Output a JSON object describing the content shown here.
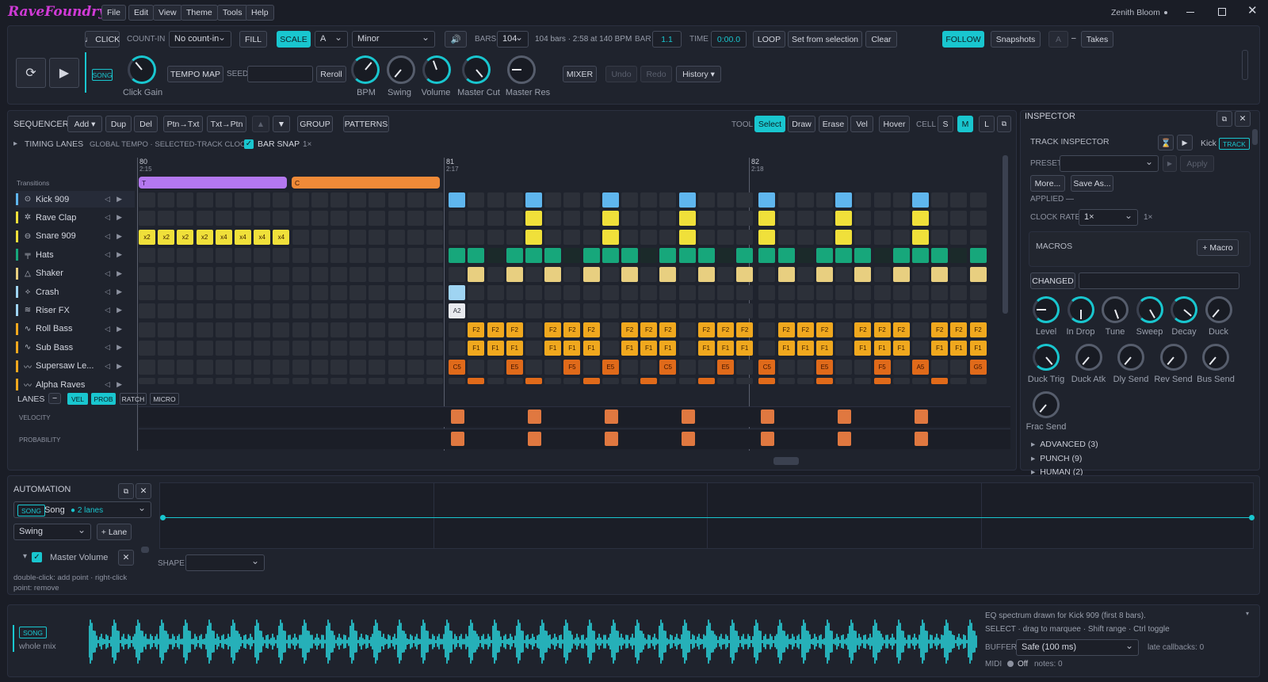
{
  "app": {
    "logo": "RaveFoundry",
    "user": "Zenith Bloom",
    "menus": [
      "File",
      "Edit",
      "View",
      "Theme",
      "Tools",
      "Help"
    ]
  },
  "transport": {
    "click": "♩ CLICK",
    "count_in_label": "COUNT-IN",
    "count_in": "No count-in",
    "fill": "FILL",
    "scale": "SCALE",
    "key": "A",
    "mode": "Minor",
    "bars_label": "BARS",
    "bars": "104",
    "bars_info": "104 bars · 2:58 at 140 BPM",
    "bar_label": "BAR",
    "bar": "1.1",
    "time_label": "TIME",
    "time": "0:00.0",
    "loop": "LOOP",
    "set_from_sel": "Set from selection",
    "clear": "Clear",
    "follow": "FOLLOW",
    "snapshots": "Snapshots",
    "snap_a": "A",
    "snap_dash": "–",
    "takes": "Takes",
    "song_badge": "SONG",
    "tempo_map": "TEMPO MAP",
    "seed_label": "SEED",
    "reroll": "Reroll",
    "mixer": "MIXER",
    "undo": "Undo",
    "redo": "Redo",
    "history": "History ▾",
    "knobs": [
      "Click Gain",
      "BPM",
      "Swing",
      "Volume",
      "Master Cut",
      "Master Res"
    ]
  },
  "sequencer": {
    "title": "SEQUENCER",
    "add": "Add ▾",
    "dup": "Dup",
    "del": "Del",
    "ptn_txt": "Ptn→Txt",
    "txt_ptn": "Txt→Ptn",
    "group": "GROUP",
    "patterns": "PATTERNS",
    "tool_label": "TOOL",
    "tools": [
      "Select",
      "Draw",
      "Erase",
      "Vel"
    ],
    "hover": "Hover",
    "cell_label": "CELL",
    "cells": [
      "S",
      "M",
      "L"
    ],
    "timing": "TIMING LANES",
    "timing_info": "GLOBAL TEMPO · SELECTED-TRACK CLOCK",
    "bar_snap": "BAR SNAP",
    "snap_mult": "1×",
    "ruler": [
      {
        "bar": "80",
        "time": "2:15"
      },
      {
        "bar": "81",
        "time": "2:17"
      },
      {
        "bar": "82",
        "time": "2:18"
      }
    ],
    "transitions_label": "Transitions",
    "transition_t": "T",
    "transition_c": "C",
    "tracks": [
      {
        "name": "Kick 909",
        "color": "#5fb6ee"
      },
      {
        "name": "Rave Clap",
        "color": "#f0e03a"
      },
      {
        "name": "Snare 909",
        "color": "#f0e03a"
      },
      {
        "name": "Hats",
        "color": "#17a77b"
      },
      {
        "name": "Shaker",
        "color": "#e8cf80"
      },
      {
        "name": "Crash",
        "color": "#9fd4f2"
      },
      {
        "name": "Riser FX",
        "color": "#9fd4f2"
      },
      {
        "name": "Roll Bass",
        "color": "#f0a81e"
      },
      {
        "name": "Sub Bass",
        "color": "#f0a81e"
      },
      {
        "name": "Supersaw Le...",
        "color": "#f0a81e"
      },
      {
        "name": "Alpha Raves",
        "color": "#f0a81e"
      }
    ],
    "note_labels": {
      "crash": "A2",
      "f2": "F2",
      "f1": "F1",
      "c5": "C5",
      "e5": "E5",
      "f5": "F5",
      "a5": "A5",
      "g5": "G5",
      "x2": "x2",
      "x4": "x4"
    },
    "lanes_label": "LANES",
    "lanes_minus": "−",
    "lane_tabs": [
      "VEL",
      "PROB",
      "RATCH",
      "MICRO"
    ],
    "lane_rows": [
      "VELOCITY",
      "PROBABILITY"
    ]
  },
  "inspector": {
    "title": "INSPECTOR",
    "track_inspector": "TRACK INSPECTOR",
    "track": "Kick",
    "track_badge": "TRACK",
    "preset_label": "PRESET",
    "apply": "Apply",
    "more": "More...",
    "save_as": "Save As...",
    "applied": "APPLIED —",
    "clock_rate_label": "CLOCK RATE",
    "clock_rate": "1×",
    "clock_rate_suffix": "1×",
    "macros": "MACROS",
    "add_macro": "+ Macro",
    "changed": "CHANGED",
    "knobs": [
      "Level",
      "In Drop",
      "Tune",
      "Sweep",
      "Decay",
      "Duck",
      "Duck Trig",
      "Duck Atk",
      "Dly Send",
      "Rev Send",
      "Bus Send",
      "Frac Send"
    ],
    "sections": [
      "ADVANCED (3)",
      "PUNCH (9)",
      "HUMAN (2)"
    ]
  },
  "automation": {
    "title": "AUTOMATION",
    "song_badge": "SONG",
    "song": "Song",
    "lanes": "● 2 lanes",
    "param": "Swing",
    "add_lane": "+ Lane",
    "master_volume": "Master Volume",
    "shape_label": "SHAPE",
    "hint": "double-click: add point · right-click point: remove"
  },
  "bottom": {
    "song_badge": "SONG",
    "mix": "whole mix",
    "eq_info": "EQ spectrum drawn for Kick 909 (first 8 bars).",
    "select_info": "SELECT · drag to marquee · Shift range · Ctrl toggle",
    "buffer_label": "BUFFER",
    "buffer": "Safe (100 ms)",
    "late": "late callbacks: 0",
    "midi_label": "MIDI",
    "midi": "Off",
    "notes": "notes: 0"
  }
}
